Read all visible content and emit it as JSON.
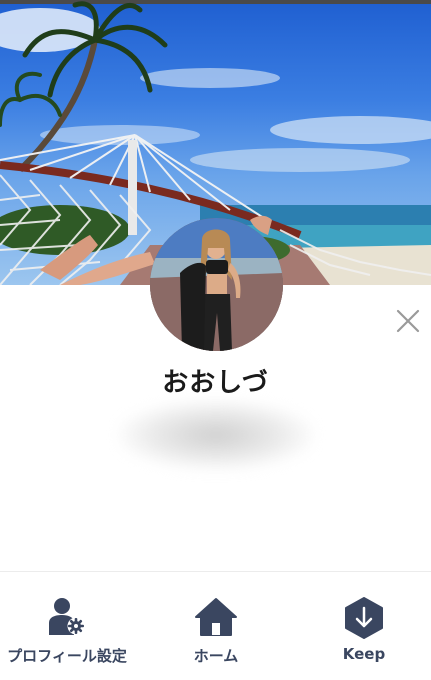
{
  "profile": {
    "name": "おおしづ"
  },
  "bottom_nav": {
    "items": [
      {
        "label": "プロフィール設定",
        "icon": "profile-settings-icon"
      },
      {
        "label": "ホーム",
        "icon": "home-icon"
      },
      {
        "label": "Keep",
        "icon": "keep-icon"
      }
    ]
  },
  "colors": {
    "nav_icon": "#3a4660",
    "name_text": "#1a1a1a",
    "close_icon": "#9a9a9a"
  }
}
